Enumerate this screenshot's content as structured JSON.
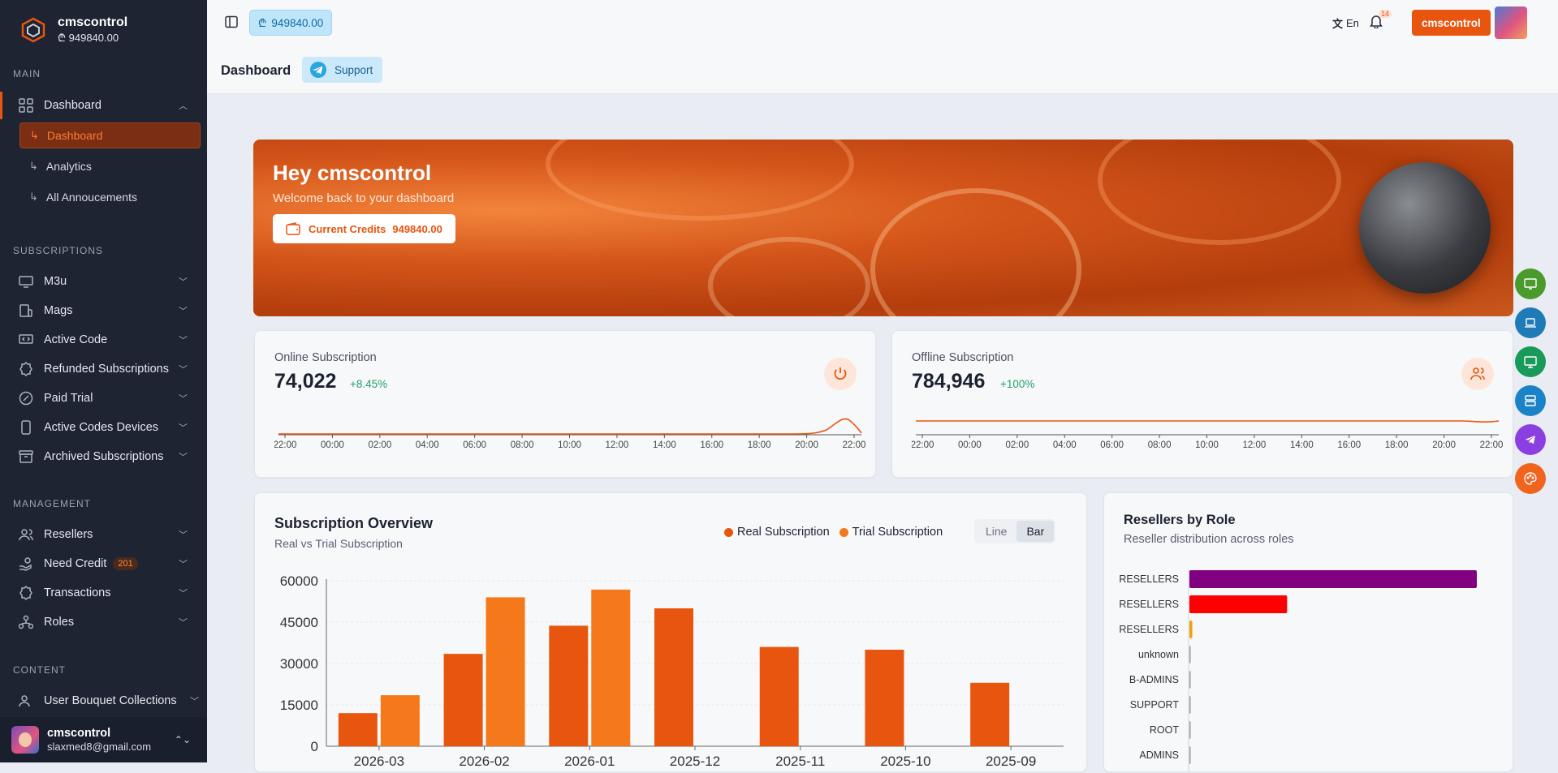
{
  "brand": {
    "name": "cmscontrol",
    "credit": "₾ 949840.00"
  },
  "sidebar": {
    "sections": {
      "main": "Main",
      "subscriptions": "Subscriptions",
      "management": "Management",
      "content": "Content"
    },
    "dashboard": {
      "label": "Dashboard",
      "children": [
        "Dashboard",
        "Analytics",
        "All Annoucements"
      ]
    },
    "subs": [
      "M3u",
      "Mags",
      "Active Code",
      "Refunded Subscriptions",
      "Paid Trial",
      "Active Codes Devices",
      "Archived Subscriptions"
    ],
    "mgmt": [
      "Resellers",
      "Need Credit",
      "Transactions",
      "Roles"
    ],
    "need_credit_badge": "201",
    "content": [
      "User Bouquet Collections"
    ]
  },
  "user": {
    "name": "cmscontrol",
    "email": "slaxmed8@gmail.com"
  },
  "topbar": {
    "credit": "949840.00",
    "lang": "En",
    "notif_count": "14",
    "account_button": "cmscontrol"
  },
  "page": {
    "title": "Dashboard",
    "support": "Support"
  },
  "banner": {
    "greeting": "Hey cmscontrol",
    "welcome": "Welcome back to your dashboard",
    "credits_label": "Current Credits",
    "credits_value": "949840.00"
  },
  "online": {
    "title": "Online Subscription",
    "value": "74,022",
    "delta": "+8.45%"
  },
  "offline": {
    "title": "Offline Subscription",
    "value": "784,946",
    "delta": "+100%"
  },
  "time_ticks": [
    "22:00",
    "00:00",
    "02:00",
    "04:00",
    "06:00",
    "08:00",
    "10:00",
    "12:00",
    "14:00",
    "16:00",
    "18:00",
    "20:00",
    "22:00"
  ],
  "overview": {
    "title": "Subscription Overview",
    "subtitle": "Real vs Trial Subscription",
    "legend_real": "Real Subscription",
    "legend_trial": "Trial Subscription",
    "btn_line": "Line",
    "btn_bar": "Bar"
  },
  "roles": {
    "title": "Resellers by Role",
    "subtitle": "Reseller distribution across roles"
  },
  "colors": {
    "accent": "#e8550e",
    "real": "#e8550e",
    "trial": "#f5781a",
    "success": "#22a06b"
  },
  "chart_data": [
    {
      "type": "bar",
      "title": "Subscription Overview",
      "categories": [
        "2026-03",
        "2026-02",
        "2026-01",
        "2025-12",
        "2025-11",
        "2025-10",
        "2025-09"
      ],
      "series": [
        {
          "name": "Real Subscription",
          "values": [
            12000,
            33500,
            43700,
            50000,
            36000,
            35000,
            23000
          ]
        },
        {
          "name": "Trial Subscription",
          "values": [
            18500,
            54000,
            56800,
            0,
            0,
            0,
            0
          ]
        }
      ],
      "yticks": [
        "0",
        "15000",
        "30000",
        "45000",
        "60000"
      ],
      "ylim": [
        0,
        60000
      ]
    },
    {
      "type": "bar",
      "title": "Resellers by Role",
      "orientation": "horizontal",
      "categories": [
        "RESELLERS",
        "RESELLERS",
        "RESELLERS",
        "unknown",
        "B-ADMINS",
        "SUPPORT",
        "ROOT",
        "ADMINS"
      ],
      "values": [
        100,
        34,
        1,
        0.4,
        0.3,
        0.2,
        0.2,
        0.2
      ],
      "colors": [
        "#800080",
        "#ff0000",
        "#f59e0b",
        "#999999",
        "#999999",
        "#999999",
        "#999999",
        "#999999"
      ]
    }
  ]
}
